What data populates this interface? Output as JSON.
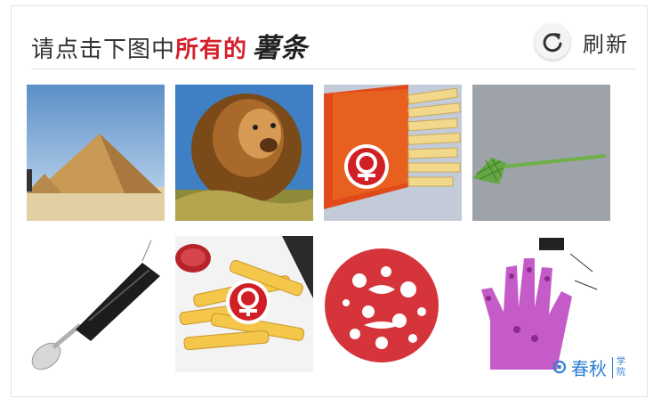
{
  "captcha": {
    "instruction_prefix": "请点击下图中",
    "instruction_highlight": "所有的",
    "instruction_target": "薯条",
    "refresh_label": "刷新",
    "tiles": [
      {
        "id": "pyramid",
        "icon": "pyramid-image"
      },
      {
        "id": "lion",
        "icon": "lion-image"
      },
      {
        "id": "fries-railway",
        "icon": "french-fries-image"
      },
      {
        "id": "fly-swatter",
        "icon": "fly-swatter-image"
      },
      {
        "id": "spoon",
        "icon": "spoon-image"
      },
      {
        "id": "fries-plate",
        "icon": "french-fries-plate-image"
      },
      {
        "id": "paper-cut",
        "icon": "red-paper-cut-image"
      },
      {
        "id": "hand-print",
        "icon": "hand-print-image"
      }
    ]
  },
  "watermark": {
    "logo": "春秋",
    "side_top": "学",
    "side_bottom": "院"
  },
  "colors": {
    "highlight": "#d5202a",
    "railway_red": "#d11f26"
  }
}
